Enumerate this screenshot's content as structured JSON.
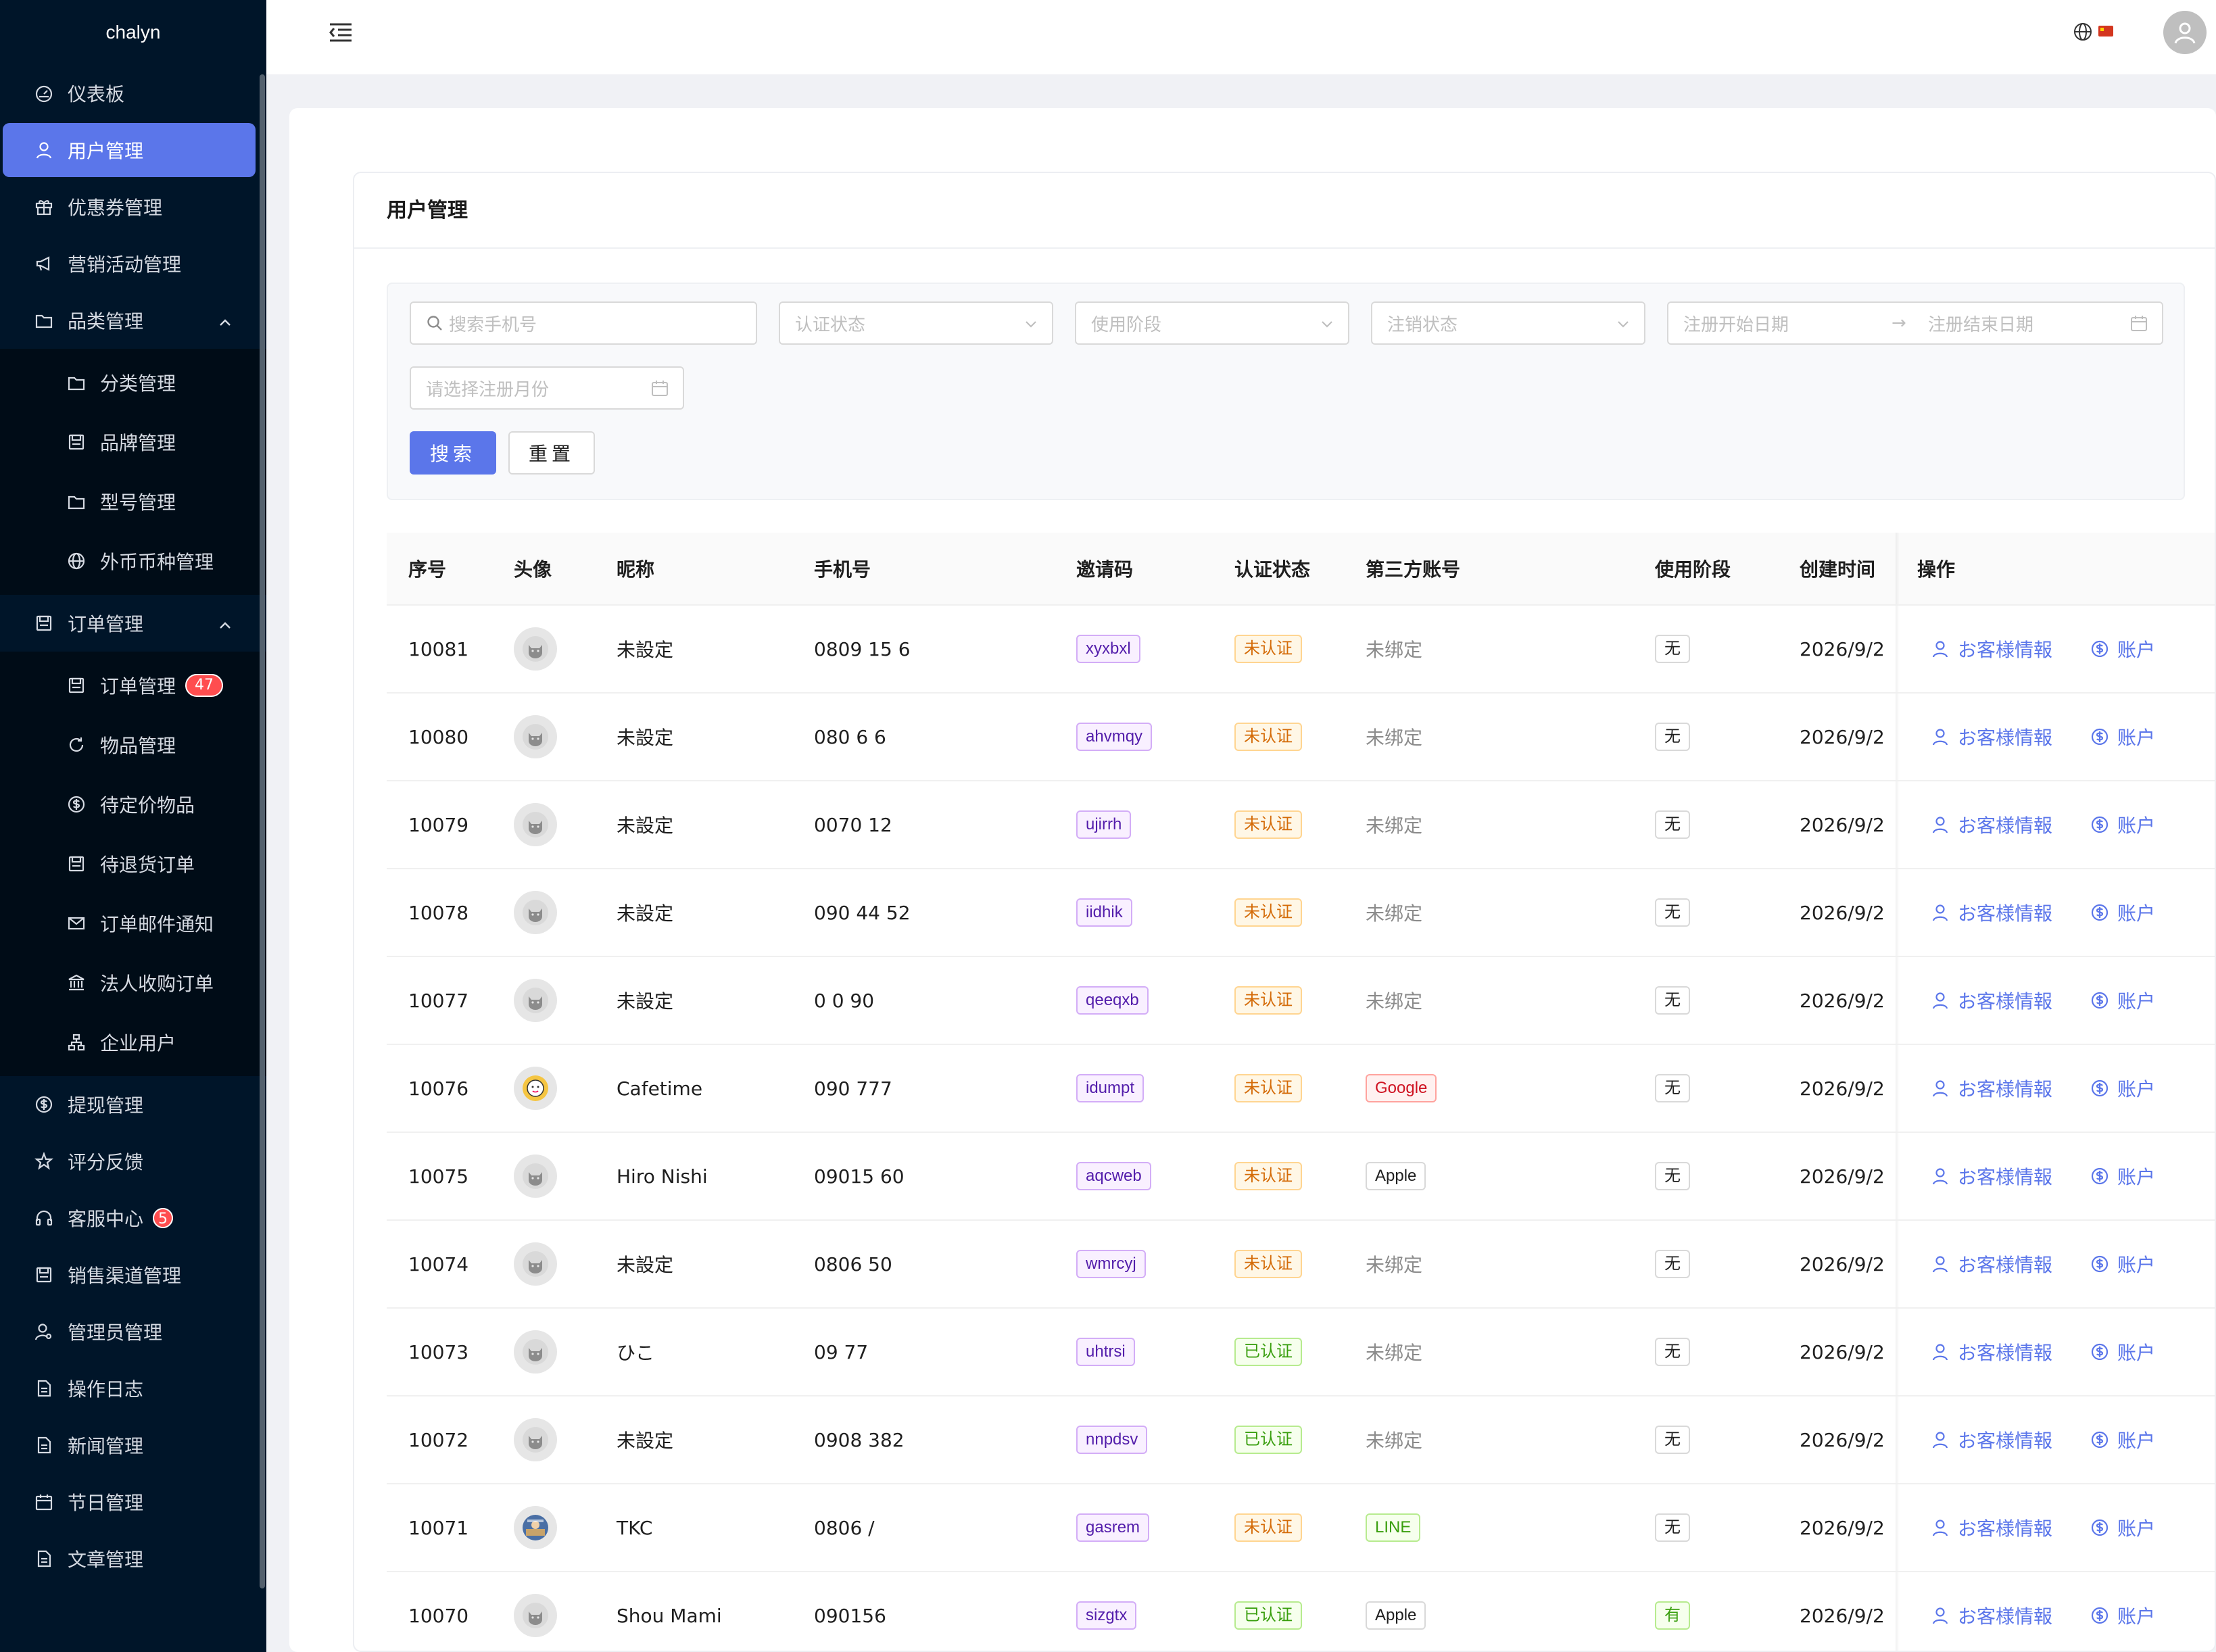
{
  "sidebar": {
    "logo": "chalyn",
    "items": [
      {
        "label": "仪表板",
        "icon": "dashboard-icon"
      },
      {
        "label": "用户管理",
        "icon": "user-icon",
        "active": true
      },
      {
        "label": "优惠券管理",
        "icon": "gift-icon"
      },
      {
        "label": "营销活动管理",
        "icon": "megaphone-icon"
      },
      {
        "label": "品类管理",
        "icon": "folder-icon",
        "expanded": true
      },
      {
        "label": "分类管理",
        "icon": "folder-icon",
        "sub": true
      },
      {
        "label": "品牌管理",
        "icon": "save-icon",
        "sub": true
      },
      {
        "label": "型号管理",
        "icon": "folder-icon",
        "sub": true
      },
      {
        "label": "外币币种管理",
        "icon": "globe-icon",
        "sub": true
      },
      {
        "label": "订单管理",
        "icon": "save-icon",
        "expanded": true
      },
      {
        "label": "订单管理",
        "icon": "save-icon",
        "sub": true,
        "badge": "47"
      },
      {
        "label": "物品管理",
        "icon": "reload-icon",
        "sub": true
      },
      {
        "label": "待定价物品",
        "icon": "dollar-icon",
        "sub": true
      },
      {
        "label": "待退货订单",
        "icon": "save-icon",
        "sub": true
      },
      {
        "label": "订单邮件通知",
        "icon": "mail-icon",
        "sub": true
      },
      {
        "label": "法人收购订单",
        "icon": "bank-icon",
        "sub": true
      },
      {
        "label": "企业用户",
        "icon": "cluster-icon",
        "sub": true
      },
      {
        "label": "提现管理",
        "icon": "dollar-icon"
      },
      {
        "label": "评分反馈",
        "icon": "star-icon"
      },
      {
        "label": "客服中心",
        "icon": "headset-icon",
        "badge": "5"
      },
      {
        "label": "销售渠道管理",
        "icon": "save-icon"
      },
      {
        "label": "管理员管理",
        "icon": "admin-icon"
      },
      {
        "label": "操作日志",
        "icon": "file-icon"
      },
      {
        "label": "新闻管理",
        "icon": "file-icon"
      },
      {
        "label": "节日管理",
        "icon": "calendar-icon"
      },
      {
        "label": "文章管理",
        "icon": "file-icon"
      }
    ]
  },
  "card": {
    "title": "用户管理"
  },
  "filters": {
    "phone_placeholder": "搜索手机号",
    "auth_placeholder": "认证状态",
    "stage_placeholder": "使用阶段",
    "cancel_placeholder": "注销状态",
    "start_date_placeholder": "注册开始日期",
    "end_date_placeholder": "注册结束日期",
    "month_placeholder": "请选择注册月份",
    "search_label": "搜索",
    "reset_label": "重置"
  },
  "table": {
    "columns": [
      "序号",
      "头像",
      "昵称",
      "手机号",
      "邀请码",
      "认证状态",
      "第三方账号",
      "使用阶段",
      "创建时间",
      "操作"
    ],
    "action_customer": "お客様情報",
    "action_account": "账户",
    "rows": [
      {
        "id": "10081",
        "avatar": "default",
        "nick": "未設定",
        "phone": "0809 15 6",
        "code": "xyxbxl",
        "auth": "未认证",
        "auth_type": "unv",
        "third": "未绑定",
        "third_type": "none",
        "stage": "无",
        "stage_type": "no",
        "created": "2026/9/2"
      },
      {
        "id": "10080",
        "avatar": "default",
        "nick": "未設定",
        "phone": "080 6 6",
        "code": "ahvmqy",
        "auth": "未认证",
        "auth_type": "unv",
        "third": "未绑定",
        "third_type": "none",
        "stage": "无",
        "stage_type": "no",
        "created": "2026/9/2"
      },
      {
        "id": "10079",
        "avatar": "default",
        "nick": "未設定",
        "phone": "0070 12",
        "code": "ujirrh",
        "auth": "未认证",
        "auth_type": "unv",
        "third": "未绑定",
        "third_type": "none",
        "stage": "无",
        "stage_type": "no",
        "created": "2026/9/2"
      },
      {
        "id": "10078",
        "avatar": "default",
        "nick": "未設定",
        "phone": "090 44 52",
        "code": "iidhik",
        "auth": "未认证",
        "auth_type": "unv",
        "third": "未绑定",
        "third_type": "none",
        "stage": "无",
        "stage_type": "no",
        "created": "2026/9/2"
      },
      {
        "id": "10077",
        "avatar": "default",
        "nick": "未設定",
        "phone": "0 0 90",
        "code": "qeeqxb",
        "auth": "未认证",
        "auth_type": "unv",
        "third": "未绑定",
        "third_type": "none",
        "stage": "无",
        "stage_type": "no",
        "created": "2026/9/2"
      },
      {
        "id": "10076",
        "avatar": "cafe",
        "nick": "Cafetime",
        "phone": "090 777",
        "code": "idumpt",
        "auth": "未认证",
        "auth_type": "unv",
        "third": "Google",
        "third_type": "google",
        "stage": "无",
        "stage_type": "no",
        "created": "2026/9/2"
      },
      {
        "id": "10075",
        "avatar": "default",
        "nick": "Hiro Nishi",
        "phone": "09015 60",
        "code": "aqcweb",
        "auth": "未认证",
        "auth_type": "unv",
        "third": "Apple",
        "third_type": "apple",
        "stage": "无",
        "stage_type": "no",
        "created": "2026/9/2"
      },
      {
        "id": "10074",
        "avatar": "default",
        "nick": "未設定",
        "phone": "0806 50",
        "code": "wmrcyj",
        "auth": "未认证",
        "auth_type": "unv",
        "third": "未绑定",
        "third_type": "none",
        "stage": "无",
        "stage_type": "no",
        "created": "2026/9/2"
      },
      {
        "id": "10073",
        "avatar": "default",
        "nick": "ひこ",
        "phone": "09 77",
        "code": "uhtrsi",
        "auth": "已认证",
        "auth_type": "ver",
        "third": "未绑定",
        "third_type": "none",
        "stage": "无",
        "stage_type": "no",
        "created": "2026/9/2"
      },
      {
        "id": "10072",
        "avatar": "default",
        "nick": "未設定",
        "phone": "0908 382",
        "code": "nnpdsv",
        "auth": "已认证",
        "auth_type": "ver",
        "third": "未绑定",
        "third_type": "none",
        "stage": "无",
        "stage_type": "no",
        "created": "2026/9/2"
      },
      {
        "id": "10071",
        "avatar": "tkc",
        "nick": "TKC",
        "phone": "0806 /",
        "code": "gasrem",
        "auth": "未认证",
        "auth_type": "unv",
        "third": "LINE",
        "third_type": "line",
        "stage": "无",
        "stage_type": "no",
        "created": "2026/9/2"
      },
      {
        "id": "10070",
        "avatar": "default",
        "nick": "Shou Mami",
        "phone": "090156",
        "code": "sizgtx",
        "auth": "已认证",
        "auth_type": "ver",
        "third": "Apple",
        "third_type": "apple",
        "stage": "有",
        "stage_type": "yes",
        "created": "2026/9/2"
      }
    ]
  },
  "colors": {
    "primary": "#5b76ea",
    "sidebar_bg": "#001529",
    "submenu_bg": "#000c17"
  }
}
